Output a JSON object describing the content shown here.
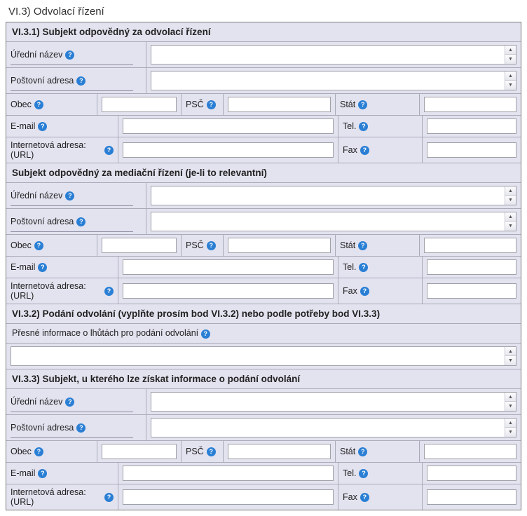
{
  "title": "VI.3) Odvolací řízení",
  "help_glyph": "?",
  "sections": {
    "s631": {
      "heading": "VI.3.1) Subjekt odpovědný za odvolací řízení",
      "official_name": {
        "label": "Úřední název",
        "value": ""
      },
      "postal_address": {
        "label": "Poštovní adresa",
        "value": ""
      },
      "city": {
        "label": "Obec",
        "value": ""
      },
      "postcode": {
        "label": "PSČ",
        "value": ""
      },
      "country": {
        "label": "Stát",
        "value": ""
      },
      "email": {
        "label": "E-mail",
        "value": ""
      },
      "tel": {
        "label": "Tel.",
        "value": ""
      },
      "url": {
        "label": "Internetová adresa: (URL)",
        "value": ""
      },
      "fax": {
        "label": "Fax",
        "value": ""
      }
    },
    "mediation": {
      "heading": "Subjekt odpovědný za mediační řízení (je-li to relevantní)",
      "official_name": {
        "label": "Úřední název",
        "value": ""
      },
      "postal_address": {
        "label": "Poštovní adresa",
        "value": ""
      },
      "city": {
        "label": "Obec",
        "value": ""
      },
      "postcode": {
        "label": "PSČ",
        "value": ""
      },
      "country": {
        "label": "Stát",
        "value": ""
      },
      "email": {
        "label": "E-mail",
        "value": ""
      },
      "tel": {
        "label": "Tel.",
        "value": ""
      },
      "url": {
        "label": "Internetová adresa: (URL)",
        "value": ""
      },
      "fax": {
        "label": "Fax",
        "value": ""
      }
    },
    "s632": {
      "heading": "VI.3.2) Podání odvolání (vyplňte prosím bod VI.3.2) nebo podle potřeby bod VI.3.3)",
      "detail_label": "Přesné informace o lhůtách pro podání odvolání",
      "detail_value": ""
    },
    "s633": {
      "heading": "VI.3.3) Subjekt, u kterého lze získat informace o podání odvolání",
      "official_name": {
        "label": "Úřední název",
        "value": ""
      },
      "postal_address": {
        "label": "Poštovní adresa",
        "value": ""
      },
      "city": {
        "label": "Obec",
        "value": ""
      },
      "postcode": {
        "label": "PSČ",
        "value": ""
      },
      "country": {
        "label": "Stát",
        "value": ""
      },
      "email": {
        "label": "E-mail",
        "value": ""
      },
      "tel": {
        "label": "Tel.",
        "value": ""
      },
      "url": {
        "label": "Internetová adresa: (URL)",
        "value": ""
      },
      "fax": {
        "label": "Fax",
        "value": ""
      }
    }
  }
}
